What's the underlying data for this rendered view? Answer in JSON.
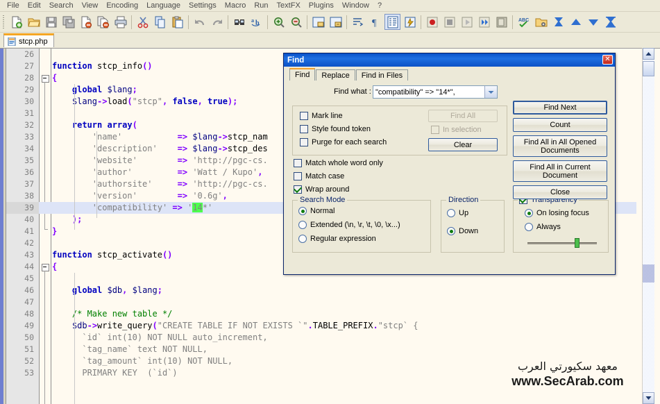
{
  "menubar": {
    "items": [
      "File",
      "Edit",
      "Search",
      "View",
      "Encoding",
      "Language",
      "Settings",
      "Macro",
      "Run",
      "TextFX",
      "Plugins",
      "Window",
      "?"
    ]
  },
  "toolbar": {
    "buttons": [
      {
        "name": "new-file-icon",
        "title": "New"
      },
      {
        "name": "open-file-icon",
        "title": "Open"
      },
      {
        "name": "save-icon",
        "title": "Save"
      },
      {
        "name": "save-all-icon",
        "title": "Save All"
      },
      {
        "name": "close-file-icon",
        "title": "Close"
      },
      {
        "name": "close-all-icon",
        "title": "Close All"
      },
      {
        "name": "print-icon",
        "title": "Print"
      },
      {
        "name": "cut-icon",
        "title": "Cut"
      },
      {
        "name": "copy-icon",
        "title": "Copy"
      },
      {
        "name": "paste-icon",
        "title": "Paste"
      },
      {
        "name": "undo-icon",
        "title": "Undo"
      },
      {
        "name": "redo-icon",
        "title": "Redo"
      },
      {
        "name": "find-icon",
        "title": "Find"
      },
      {
        "name": "replace-icon",
        "title": "Replace"
      },
      {
        "name": "zoom-in-icon",
        "title": "Zoom In"
      },
      {
        "name": "zoom-out-icon",
        "title": "Zoom Out"
      },
      {
        "name": "sync-vertical-icon",
        "title": "Synchronize Vertical Scrolling"
      },
      {
        "name": "sync-horizontal-icon",
        "title": "Synchronize Horizontal Scrolling"
      },
      {
        "name": "word-wrap-icon",
        "title": "Word Wrap"
      },
      {
        "name": "show-all-chars-icon",
        "title": "Show All Characters"
      },
      {
        "name": "indent-guide-icon",
        "title": "Show Indent Guide"
      },
      {
        "name": "user-language-icon",
        "title": "User Defined Dialogue"
      },
      {
        "name": "record-macro-icon",
        "title": "Start Recording"
      },
      {
        "name": "stop-macro-icon",
        "title": "Stop Recording"
      },
      {
        "name": "play-macro-icon",
        "title": "Playback"
      },
      {
        "name": "run-macro-multiple-icon",
        "title": "Run a Macro Multiple Times"
      },
      {
        "name": "save-macro-icon",
        "title": "Save Current Recorded Macro"
      },
      {
        "name": "spellcheck-icon",
        "title": "Spell Check"
      },
      {
        "name": "explorer-icon",
        "title": "Open Folder"
      },
      {
        "name": "collapse-all-icon",
        "title": "Collapse All"
      },
      {
        "name": "expand-up-icon",
        "title": "Fold Up"
      },
      {
        "name": "expand-down-icon",
        "title": "Unfold"
      },
      {
        "name": "uncollapse-all-icon",
        "title": "Uncollapse All"
      }
    ]
  },
  "tab": {
    "label": "stcp.php"
  },
  "editor": {
    "first_line": 26,
    "current_line": 39,
    "lines": [
      {
        "n": 26,
        "tokens": []
      },
      {
        "n": 27,
        "tokens": [
          {
            "t": "function ",
            "c": "t-kw"
          },
          {
            "t": "stcp_info",
            "c": "t-def"
          },
          {
            "t": "()",
            "c": "t-op"
          }
        ]
      },
      {
        "n": 28,
        "tokens": [
          {
            "t": "{",
            "c": "t-op"
          }
        ]
      },
      {
        "n": 29,
        "tokens": [
          {
            "t": "    global ",
            "c": "t-kw"
          },
          {
            "t": "$lang",
            "c": "t-var"
          },
          {
            "t": ";",
            "c": "t-op"
          }
        ]
      },
      {
        "n": 30,
        "tokens": [
          {
            "t": "    ",
            "c": "t-def"
          },
          {
            "t": "$lang",
            "c": "t-var"
          },
          {
            "t": "->",
            "c": "t-op"
          },
          {
            "t": "load",
            "c": "t-def"
          },
          {
            "t": "(",
            "c": "t-op"
          },
          {
            "t": "\"stcp\"",
            "c": "t-str"
          },
          {
            "t": ", ",
            "c": "t-op"
          },
          {
            "t": "false",
            "c": "t-kw"
          },
          {
            "t": ", ",
            "c": "t-op"
          },
          {
            "t": "true",
            "c": "t-kw"
          },
          {
            "t": ");",
            "c": "t-op"
          }
        ]
      },
      {
        "n": 31,
        "tokens": []
      },
      {
        "n": 32,
        "tokens": [
          {
            "t": "    return array",
            "c": "t-kw"
          },
          {
            "t": "(",
            "c": "t-op"
          }
        ]
      },
      {
        "n": 33,
        "tokens": [
          {
            "t": "        'name'           ",
            "c": "t-str"
          },
          {
            "t": "=> ",
            "c": "t-op"
          },
          {
            "t": "$lang",
            "c": "t-var"
          },
          {
            "t": "->",
            "c": "t-op"
          },
          {
            "t": "stcp_nam",
            "c": "t-def"
          }
        ]
      },
      {
        "n": 34,
        "tokens": [
          {
            "t": "        'description'    ",
            "c": "t-str"
          },
          {
            "t": "=> ",
            "c": "t-op"
          },
          {
            "t": "$lang",
            "c": "t-var"
          },
          {
            "t": "->",
            "c": "t-op"
          },
          {
            "t": "stcp_des",
            "c": "t-def"
          }
        ]
      },
      {
        "n": 35,
        "tokens": [
          {
            "t": "        'website'        ",
            "c": "t-str"
          },
          {
            "t": "=> ",
            "c": "t-op"
          },
          {
            "t": "'http://pgc-cs.",
            "c": "t-str"
          }
        ]
      },
      {
        "n": 36,
        "tokens": [
          {
            "t": "        'author'         ",
            "c": "t-str"
          },
          {
            "t": "=> ",
            "c": "t-op"
          },
          {
            "t": "'Watt / Kupo'",
            "c": "t-str"
          },
          {
            "t": ",",
            "c": "t-op"
          }
        ]
      },
      {
        "n": 37,
        "tokens": [
          {
            "t": "        'authorsite'     ",
            "c": "t-str"
          },
          {
            "t": "=> ",
            "c": "t-op"
          },
          {
            "t": "'http://pgc-cs.",
            "c": "t-str"
          }
        ]
      },
      {
        "n": 38,
        "tokens": [
          {
            "t": "        'version'        ",
            "c": "t-str"
          },
          {
            "t": "=> ",
            "c": "t-op"
          },
          {
            "t": "'0.6g'",
            "c": "t-str"
          },
          {
            "t": ",",
            "c": "t-op"
          }
        ]
      },
      {
        "n": 39,
        "tokens": [
          {
            "t": "        'compatibility' ",
            "c": "t-str"
          },
          {
            "t": "=> ",
            "c": "t-op"
          },
          {
            "t": "'",
            "c": "t-str"
          },
          {
            "t": "14",
            "c": "t-str hl"
          },
          {
            "t": "*'",
            "c": "t-str"
          }
        ]
      },
      {
        "n": 40,
        "tokens": [
          {
            "t": "    );",
            "c": "t-op"
          }
        ]
      },
      {
        "n": 41,
        "tokens": [
          {
            "t": "}",
            "c": "t-op"
          }
        ]
      },
      {
        "n": 42,
        "tokens": []
      },
      {
        "n": 43,
        "tokens": [
          {
            "t": "function ",
            "c": "t-kw"
          },
          {
            "t": "stcp_activate",
            "c": "t-def"
          },
          {
            "t": "()",
            "c": "t-op"
          }
        ]
      },
      {
        "n": 44,
        "tokens": [
          {
            "t": "{",
            "c": "t-op"
          }
        ]
      },
      {
        "n": 45,
        "tokens": []
      },
      {
        "n": 46,
        "tokens": [
          {
            "t": "    global ",
            "c": "t-kw"
          },
          {
            "t": "$db",
            "c": "t-var"
          },
          {
            "t": ", ",
            "c": "t-op"
          },
          {
            "t": "$lang",
            "c": "t-var"
          },
          {
            "t": ";",
            "c": "t-op"
          }
        ]
      },
      {
        "n": 47,
        "tokens": []
      },
      {
        "n": 48,
        "tokens": [
          {
            "t": "    /* Make new table */",
            "c": "t-cmt"
          }
        ]
      },
      {
        "n": 49,
        "tokens": [
          {
            "t": "    ",
            "c": "t-def"
          },
          {
            "t": "$db",
            "c": "t-var"
          },
          {
            "t": "->",
            "c": "t-op"
          },
          {
            "t": "write_query",
            "c": "t-def"
          },
          {
            "t": "(",
            "c": "t-op"
          },
          {
            "t": "\"CREATE TABLE IF NOT EXISTS `\"",
            "c": "t-sql"
          },
          {
            "t": ".",
            "c": "t-op"
          },
          {
            "t": "TABLE_PREFIX",
            "c": "t-def"
          },
          {
            "t": ".",
            "c": "t-op"
          },
          {
            "t": "\"stcp` {",
            "c": "t-sql"
          }
        ]
      },
      {
        "n": 50,
        "tokens": [
          {
            "t": "      `id` int(10) NOT NULL auto_increment,",
            "c": "t-sql"
          }
        ]
      },
      {
        "n": 51,
        "tokens": [
          {
            "t": "      `tag_name` text NOT NULL,",
            "c": "t-sql"
          }
        ]
      },
      {
        "n": 52,
        "tokens": [
          {
            "t": "      `tag_amount` int(10) NOT NULL,",
            "c": "t-sql"
          }
        ]
      },
      {
        "n": 53,
        "tokens": [
          {
            "t": "      PRIMARY KEY  (`id`)",
            "c": "t-sql"
          }
        ]
      }
    ]
  },
  "watermark": {
    "arabic": "معهد سكيورتي العرب",
    "url": "www.SecArab.com"
  },
  "find_dialog": {
    "title": "Find",
    "close_label": "✕",
    "tabs": [
      {
        "label": "Find",
        "selected": true
      },
      {
        "label": "Replace",
        "selected": false
      },
      {
        "label": "Find in Files",
        "selected": false
      }
    ],
    "find_what_label": "Find what :",
    "find_what_value": "\"compatibility\" => \"14*\",",
    "find_what_placeholder": "",
    "mark_group": {
      "mark_line": {
        "label": "Mark line",
        "checked": false
      },
      "style_found_token": {
        "label": "Style found token",
        "checked": false
      },
      "purge_for_each_search": {
        "label": "Purge for each search",
        "checked": false
      },
      "find_all_label": "Find All",
      "find_all_enabled": false,
      "in_selection": {
        "label": "In selection",
        "checked": false,
        "enabled": false
      },
      "clear_label": "Clear"
    },
    "match_whole_word_only": {
      "label": "Match whole word only",
      "checked": false
    },
    "match_case": {
      "label": "Match case",
      "checked": false
    },
    "wrap_around": {
      "label": "Wrap around",
      "checked": true
    },
    "search_mode": {
      "label": "Search Mode",
      "options": [
        {
          "label": "Normal",
          "selected": true
        },
        {
          "label": "Extended (\\n, \\r, \\t, \\0, \\x...)",
          "selected": false
        },
        {
          "label": "Regular expression",
          "selected": false
        }
      ]
    },
    "direction": {
      "label": "Direction",
      "options": [
        {
          "label": "Up",
          "selected": false
        },
        {
          "label": "Down",
          "selected": true
        }
      ]
    },
    "transparency": {
      "label": "Transparency",
      "checked": true,
      "options": [
        {
          "label": "On losing focus",
          "selected": true
        },
        {
          "label": "Always",
          "selected": false
        }
      ],
      "slider_percent": 68
    },
    "buttons": {
      "find_next": "Find Next",
      "count": "Count",
      "find_all_opened": "Find All in All Opened\nDocuments",
      "find_all_opened_l1": "Find All in All Opened",
      "find_all_opened_l2": "Documents",
      "find_all_current_l1": "Find All in Current",
      "find_all_current_l2": "Document",
      "close": "Close"
    }
  },
  "colors": {
    "dialog_title": "#1f6fe0",
    "accent_tab": "#f0a030",
    "highlight_green": "#4dff4d",
    "keyword_blue": "#0000c0",
    "operator_purple": "#8000ff",
    "comment_green": "#008000",
    "editor_bg": "#fffaf0",
    "window_bg": "#ece9d8"
  }
}
